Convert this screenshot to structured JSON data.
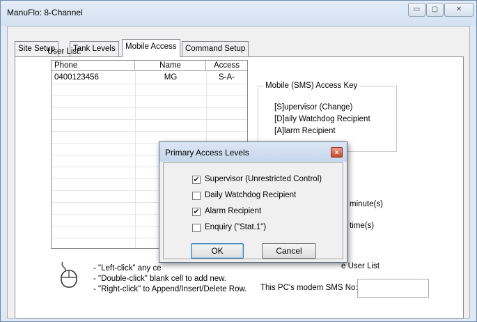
{
  "window": {
    "title": "ManuFlo: 8-Channel",
    "controls": {
      "minimize": "▭",
      "maximize": "▢",
      "close": "✕"
    }
  },
  "tabs": [
    {
      "label": "Site Setup",
      "active": false
    },
    {
      "label": "Tank Levels",
      "active": false
    },
    {
      "label": "Mobile Access",
      "active": true
    },
    {
      "label": "Command Setup",
      "active": false
    }
  ],
  "user_list": {
    "label": "User List:",
    "columns": [
      "Phone",
      "Name",
      "Access"
    ],
    "rows": [
      {
        "phone": "0400123456",
        "name": "MG",
        "access": "S-A-"
      }
    ]
  },
  "access_key": {
    "title": "Mobile (SMS) Access Key",
    "items": [
      "[S]upervisor (Change)",
      "[D]aily Watchdog Recipient",
      "[A]larm Recipient"
    ]
  },
  "misc": {
    "minute_text": "minute(s)",
    "time_text": "time(s)",
    "user_list_text": "e User List",
    "modem_label": "This PC's modem SMS No:",
    "modem_value": ""
  },
  "hints": {
    "line1": "- \"Left-click\" any ce",
    "line2": "- \"Double-click\" blank cell to add new.",
    "line3": "- \"Right-click\" to Append/Insert/Delete Row."
  },
  "dialog": {
    "title": "Primary Access Levels",
    "close_glyph": "x",
    "options": [
      {
        "label": "Supervisor (Unrestricted Control)",
        "checked": true
      },
      {
        "label": "Daily Watchdog Recipient",
        "checked": false
      },
      {
        "label": "Alarm Recipient",
        "checked": true
      },
      {
        "label": "Enquiry (\"Stat.1\")",
        "checked": false
      }
    ],
    "ok_label": "OK",
    "cancel_label": "Cancel"
  },
  "colors": {
    "accent": "#3c7fb1",
    "close": "#c6452c"
  }
}
